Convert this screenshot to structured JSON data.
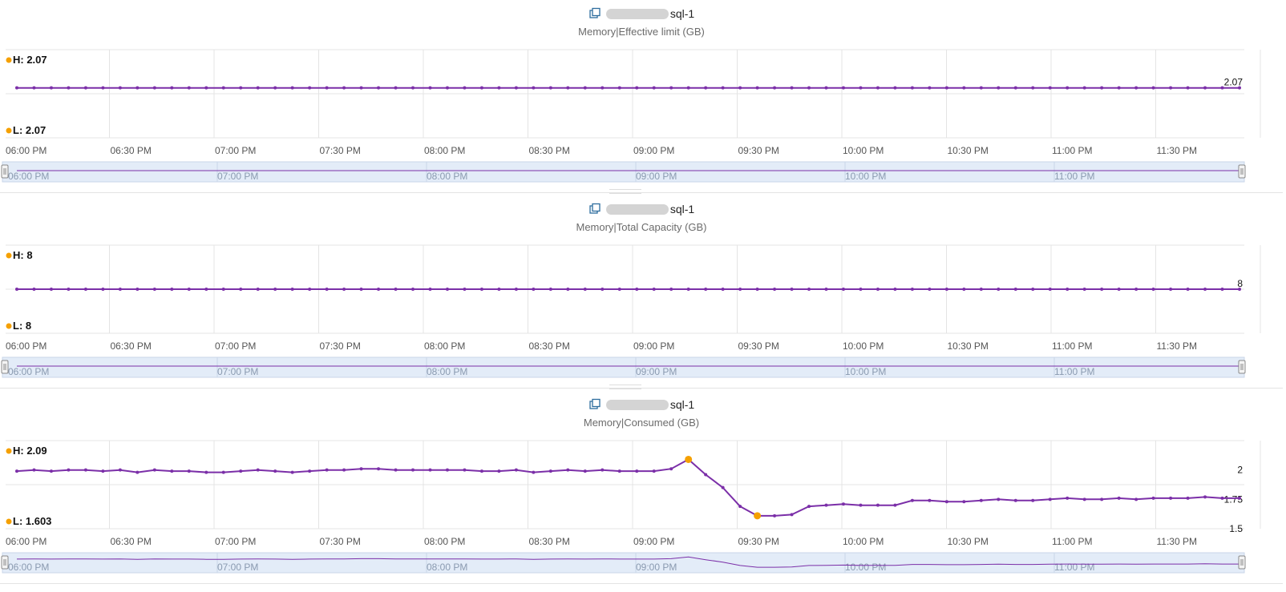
{
  "panels": [
    {
      "object_name": "sql-1",
      "metric": "Memory|Effective limit (GB)",
      "high_label": "H: 2.07",
      "low_label": "L: 2.07"
    },
    {
      "object_name": "sql-1",
      "metric": "Memory|Total Capacity (GB)",
      "high_label": "H: 8",
      "low_label": "L: 8"
    },
    {
      "object_name": "sql-1",
      "metric": "Memory|Consumed (GB)",
      "high_label": "H: 2.09",
      "low_label": "L: 1.603"
    }
  ],
  "colors": {
    "series": "#7b2fa8",
    "highlow": "#f5a000",
    "nav_bg": "#e3ecf8",
    "grid": "#e4e4e4",
    "icon": "#2d6d9e"
  },
  "icons": {
    "object": "vm-stack-icon",
    "handle": "range-handle-icon"
  },
  "chart_data": [
    {
      "type": "line",
      "title": "Memory|Effective limit (GB)",
      "x_ticks": [
        "06:00 PM",
        "06:30 PM",
        "07:00 PM",
        "07:30 PM",
        "08:00 PM",
        "08:30 PM",
        "09:00 PM",
        "09:30 PM",
        "10:00 PM",
        "10:30 PM",
        "11:00 PM",
        "11:30 PM"
      ],
      "nav_ticks": [
        "06:00 PM",
        "07:00 PM",
        "08:00 PM",
        "09:00 PM",
        "10:00 PM",
        "11:00 PM"
      ],
      "y_range": [
        1.9,
        2.2
      ],
      "y_ticks": [],
      "end_label": "2.07",
      "x_start": "06:00 PM",
      "x_interval_min": 5,
      "values": [
        2.07,
        2.07,
        2.07,
        2.07,
        2.07,
        2.07,
        2.07,
        2.07,
        2.07,
        2.07,
        2.07,
        2.07,
        2.07,
        2.07,
        2.07,
        2.07,
        2.07,
        2.07,
        2.07,
        2.07,
        2.07,
        2.07,
        2.07,
        2.07,
        2.07,
        2.07,
        2.07,
        2.07,
        2.07,
        2.07,
        2.07,
        2.07,
        2.07,
        2.07,
        2.07,
        2.07,
        2.07,
        2.07,
        2.07,
        2.07,
        2.07,
        2.07,
        2.07,
        2.07,
        2.07,
        2.07,
        2.07,
        2.07,
        2.07,
        2.07,
        2.07,
        2.07,
        2.07,
        2.07,
        2.07,
        2.07,
        2.07,
        2.07,
        2.07,
        2.07,
        2.07,
        2.07,
        2.07,
        2.07,
        2.07,
        2.07,
        2.07,
        2.07,
        2.07,
        2.07,
        2.07,
        2.07
      ],
      "high": 2.07,
      "low": 2.07,
      "high_index": null,
      "low_index": null
    },
    {
      "type": "line",
      "title": "Memory|Total Capacity (GB)",
      "x_ticks": [
        "06:00 PM",
        "06:30 PM",
        "07:00 PM",
        "07:30 PM",
        "08:00 PM",
        "08:30 PM",
        "09:00 PM",
        "09:30 PM",
        "10:00 PM",
        "10:30 PM",
        "11:00 PM",
        "11:30 PM"
      ],
      "nav_ticks": [
        "06:00 PM",
        "07:00 PM",
        "08:00 PM",
        "09:00 PM",
        "10:00 PM",
        "11:00 PM"
      ],
      "y_range": [
        7,
        9
      ],
      "y_ticks": [],
      "end_label": "8",
      "x_start": "06:00 PM",
      "x_interval_min": 5,
      "values": [
        8,
        8,
        8,
        8,
        8,
        8,
        8,
        8,
        8,
        8,
        8,
        8,
        8,
        8,
        8,
        8,
        8,
        8,
        8,
        8,
        8,
        8,
        8,
        8,
        8,
        8,
        8,
        8,
        8,
        8,
        8,
        8,
        8,
        8,
        8,
        8,
        8,
        8,
        8,
        8,
        8,
        8,
        8,
        8,
        8,
        8,
        8,
        8,
        8,
        8,
        8,
        8,
        8,
        8,
        8,
        8,
        8,
        8,
        8,
        8,
        8,
        8,
        8,
        8,
        8,
        8,
        8,
        8,
        8,
        8,
        8,
        8
      ],
      "high": 8,
      "low": 8,
      "high_index": null,
      "low_index": null
    },
    {
      "type": "line",
      "title": "Memory|Consumed (GB)",
      "x_ticks": [
        "06:00 PM",
        "06:30 PM",
        "07:00 PM",
        "07:30 PM",
        "08:00 PM",
        "08:30 PM",
        "09:00 PM",
        "09:30 PM",
        "10:00 PM",
        "10:30 PM",
        "11:00 PM",
        "11:30 PM"
      ],
      "nav_ticks": [
        "06:00 PM",
        "07:00 PM",
        "08:00 PM",
        "09:00 PM",
        "10:00 PM",
        "11:00 PM"
      ],
      "y_range": [
        1.5,
        2.25
      ],
      "y_ticks": [
        "2",
        "1.75",
        "1.5"
      ],
      "end_label": "",
      "x_start": "06:00 PM",
      "x_interval_min": 5,
      "values": [
        1.99,
        2.0,
        1.99,
        2.0,
        2.0,
        1.99,
        2.0,
        1.98,
        2.0,
        1.99,
        1.99,
        1.98,
        1.98,
        1.99,
        2.0,
        1.99,
        1.98,
        1.99,
        2.0,
        2.0,
        2.01,
        2.01,
        2.0,
        2.0,
        2.0,
        2.0,
        2.0,
        1.99,
        1.99,
        2.0,
        1.98,
        1.99,
        2.0,
        1.99,
        2.0,
        1.99,
        1.99,
        1.99,
        2.01,
        2.09,
        1.96,
        1.85,
        1.69,
        1.61,
        1.61,
        1.62,
        1.69,
        1.7,
        1.71,
        1.7,
        1.7,
        1.7,
        1.74,
        1.74,
        1.73,
        1.73,
        1.74,
        1.75,
        1.74,
        1.74,
        1.75,
        1.76,
        1.75,
        1.75,
        1.76,
        1.75,
        1.76,
        1.76,
        1.76,
        1.77,
        1.76,
        1.76
      ],
      "high": 2.09,
      "low": 1.603,
      "high_index": 39,
      "low_index": 43
    }
  ]
}
